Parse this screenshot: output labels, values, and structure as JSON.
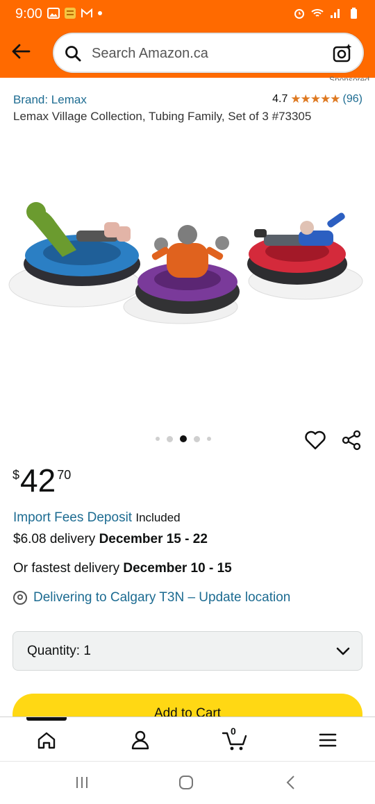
{
  "status_bar": {
    "time": "9:00",
    "icons_left": [
      "image-icon",
      "app-icon",
      "gmail-icon",
      "dot-icon"
    ],
    "icons_right": [
      "alarm-icon",
      "wifi-icon",
      "signal-icon",
      "battery-icon"
    ]
  },
  "header": {
    "search_placeholder": "Search Amazon.ca",
    "sponsored_label": "Sponsored"
  },
  "product": {
    "brand": "Brand: Lemax",
    "rating_value": "4.7",
    "stars": "★★★★★",
    "rating_count": "(96)",
    "title": "Lemax Village Collection, Tubing Family, Set of 3 #73305",
    "image_alt": "Three figurines on snow tubes (blue, purple, red)",
    "image_carousel_total": 5,
    "image_carousel_active": 3
  },
  "price": {
    "currency": "$",
    "whole": "42",
    "fraction": "70"
  },
  "fees": {
    "link_text": "Import Fees Deposit",
    "included_text": "Included"
  },
  "delivery": {
    "prefix": "$6.08 delivery",
    "dates": "December 15 - 22",
    "fastest_prefix": "Or fastest delivery",
    "fastest_dates": "December 10 - 15",
    "location_text": "Delivering to Calgary T3N – Update location"
  },
  "quantity": {
    "label": "Quantity:",
    "value": "1"
  },
  "cart_button": {
    "label": "Add to Cart"
  },
  "bottom_nav": {
    "cart_count": "0"
  },
  "colors": {
    "header_orange": "#ff6a00",
    "link_blue": "#1c6b91",
    "star_orange": "#de7921",
    "cart_yellow": "#ffd814"
  }
}
